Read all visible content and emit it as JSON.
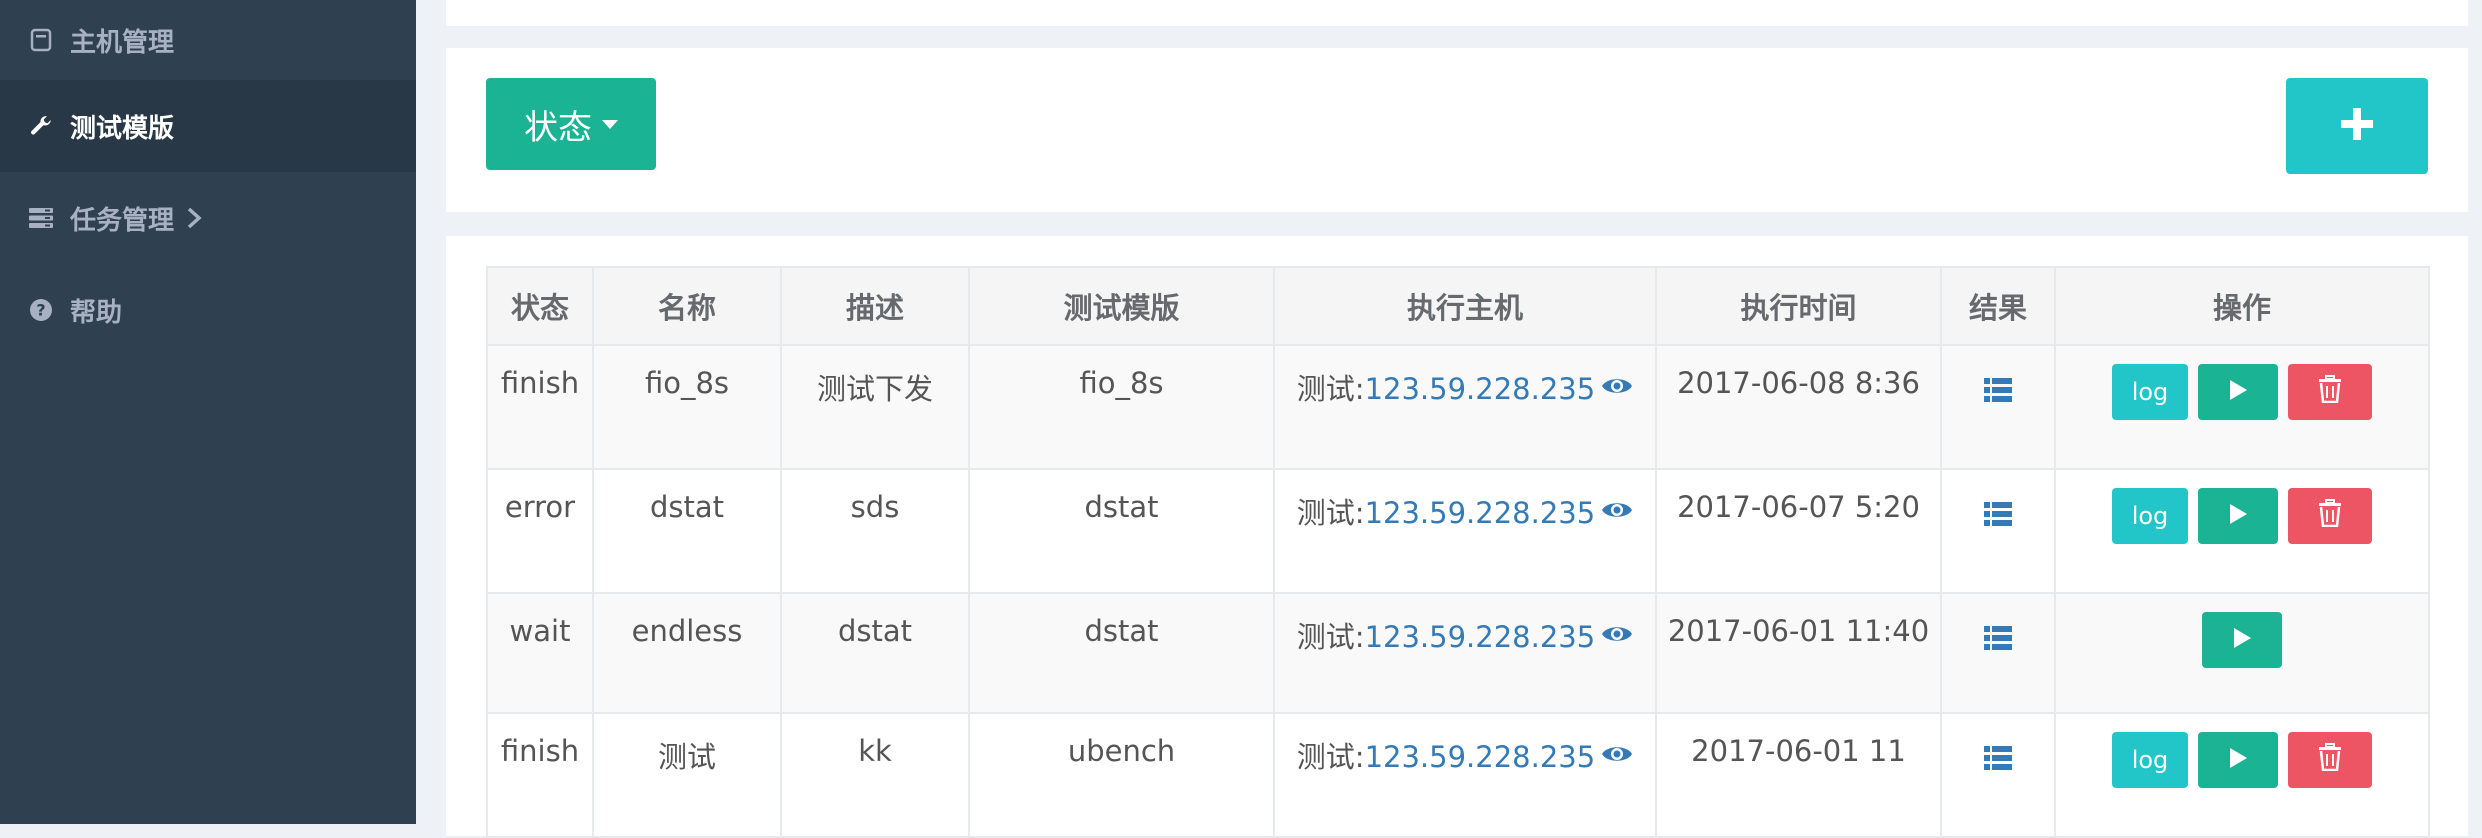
{
  "sidebar": {
    "items": [
      {
        "label": "主机管理",
        "icon": "server-box-icon",
        "active": false
      },
      {
        "label": "测试模版",
        "icon": "wrench-icon",
        "active": true
      },
      {
        "label": "任务管理",
        "icon": "tasks-icon",
        "active": false,
        "has_submenu": true
      },
      {
        "label": "帮助",
        "icon": "question-circle-icon",
        "active": false
      }
    ]
  },
  "toolbar": {
    "status_label": "状态",
    "add_icon": "plus-icon"
  },
  "table": {
    "headers": [
      "状态",
      "名称",
      "描述",
      "测试模版",
      "执行主机",
      "执行时间",
      "结果",
      "操作"
    ],
    "log_label": "log",
    "rows": [
      {
        "status": "finish",
        "name": "fio_8s",
        "desc": "测试下发",
        "template": "fio_8s",
        "host_prefix": "测试:",
        "host_ip": "123.59.228.235",
        "time": "2017-06-08 8:36",
        "ops": [
          "log",
          "run",
          "delete"
        ]
      },
      {
        "status": "error",
        "name": "dstat",
        "desc": "sds",
        "template": "dstat",
        "host_prefix": "测试:",
        "host_ip": "123.59.228.235",
        "time": "2017-06-07 5:20",
        "ops": [
          "log",
          "run",
          "delete"
        ]
      },
      {
        "status": "wait",
        "name": "endless",
        "desc": "dstat",
        "template": "dstat",
        "host_prefix": "测试:",
        "host_ip": "123.59.228.235",
        "time": "2017-06-01 11:40",
        "ops": [
          "run"
        ]
      },
      {
        "status": "finish",
        "name": "测试",
        "desc": "kk",
        "template": "ubench",
        "host_prefix": "测试:",
        "host_ip": "123.59.228.235",
        "time": "2017-06-01 11",
        "ops": [
          "log",
          "run",
          "delete"
        ]
      }
    ]
  },
  "colors": {
    "sidebar_bg": "#2f4050",
    "sidebar_active_bg": "#293846",
    "primary": "#1ab394",
    "info": "#23c6c8",
    "danger": "#ed5565",
    "link": "#337ab7"
  }
}
